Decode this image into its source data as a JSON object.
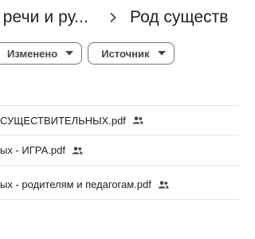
{
  "breadcrumb": {
    "parent": "е речи и ру...",
    "separator_icon": "chevron-right-icon",
    "current": "Род существ"
  },
  "filters": [
    {
      "label": "Изменено",
      "icon": "dropdown-arrow-icon"
    },
    {
      "label": "Источник",
      "icon": "dropdown-arrow-icon"
    }
  ],
  "files": [
    {
      "name": "СУЩЕСТВИТЕЛЬНЫХ.pdf",
      "icon": "shared-people-icon"
    },
    {
      "name": "ых - ИГРА.pdf",
      "icon": "shared-people-icon"
    },
    {
      "name": "ых - родителям и педагогам.pdf",
      "icon": "shared-people-icon"
    }
  ]
}
